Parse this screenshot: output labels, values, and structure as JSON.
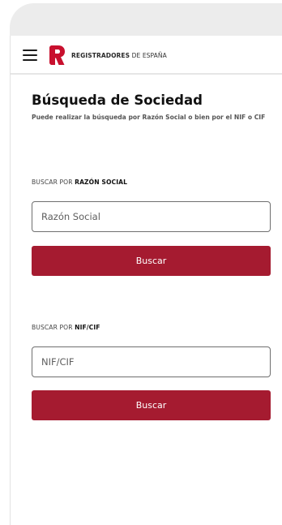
{
  "header": {
    "brand_bold": "REGISTRADORES",
    "brand_rest": " DE ESPAÑA",
    "brand_color": "#c8102e"
  },
  "page": {
    "title": "Búsqueda de Sociedad",
    "subtitle": "Puede realizar la búsqueda por Razón Social o bien por el NIF o CIF"
  },
  "razon_social": {
    "label_prefix": "BUSCAR POR ",
    "label_strong": "RAZÓN SOCIAL",
    "input_placeholder": "Razón Social",
    "input_value": "",
    "button_label": "Buscar"
  },
  "nif_cif": {
    "label_prefix": "BUSCAR POR ",
    "label_strong": "NIF/CIF",
    "input_placeholder": "NIF/CIF",
    "input_value": "",
    "button_label": "Buscar"
  },
  "colors": {
    "button_bg": "#a51b30",
    "logo_red": "#c8102e"
  },
  "icons": {
    "menu": "hamburger-menu-icon",
    "logo": "registradores-logo-icon"
  }
}
